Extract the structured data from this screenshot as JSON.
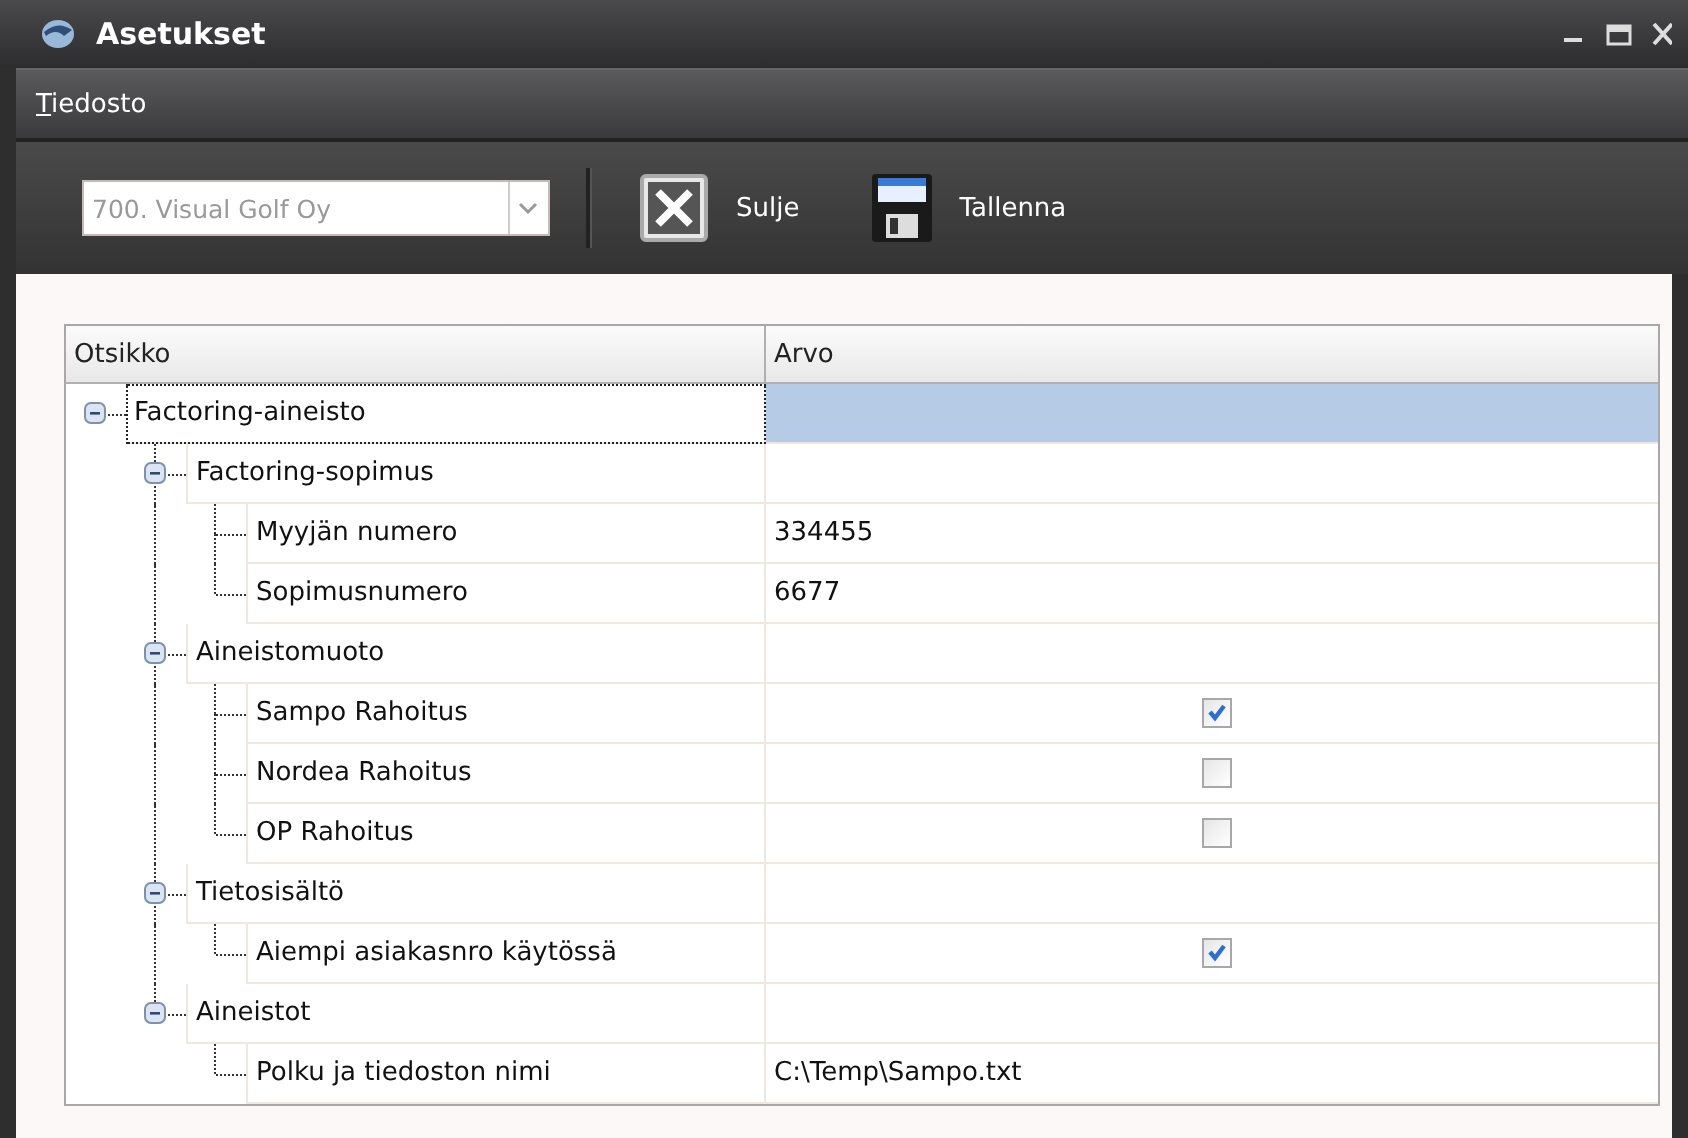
{
  "window": {
    "title": "Asetukset"
  },
  "menu": [
    {
      "label": "Tiedosto"
    }
  ],
  "toolbar": {
    "company_select": {
      "value": "700. Visual Golf Oy",
      "disabled": true
    },
    "buttons": [
      {
        "kind": "close",
        "label": "Sulje"
      },
      {
        "kind": "save",
        "label": "Tallenna"
      }
    ]
  },
  "table": {
    "columns": [
      "Otsikko",
      "Arvo"
    ],
    "rows": [
      {
        "kind": "group",
        "label": "Factoring-aineisto",
        "expanded": true,
        "selected": true,
        "children": [
          {
            "kind": "group",
            "label": "Factoring-sopimus",
            "expanded": true,
            "selected": false,
            "children": [
              {
                "kind": "text",
                "label": "Myyjän numero",
                "value": "334455",
                "selected": false
              },
              {
                "kind": "text",
                "label": "Sopimusnumero",
                "value": "6677",
                "selected": false
              }
            ]
          },
          {
            "kind": "group",
            "label": "Aineistomuoto",
            "expanded": true,
            "selected": false,
            "children": [
              {
                "kind": "checkbox",
                "label": "Sampo Rahoitus",
                "checked": true,
                "selected": false
              },
              {
                "kind": "checkbox",
                "label": "Nordea Rahoitus",
                "checked": false,
                "selected": false
              },
              {
                "kind": "checkbox",
                "label": "OP Rahoitus",
                "checked": false,
                "selected": false
              }
            ]
          },
          {
            "kind": "group",
            "label": "Tietosisältö",
            "expanded": true,
            "selected": false,
            "children": [
              {
                "kind": "checkbox",
                "label": "Aiempi asiakasnro käytössä",
                "checked": true,
                "selected": false
              }
            ]
          },
          {
            "kind": "group",
            "label": "Aineistot",
            "expanded": true,
            "selected": false,
            "children": [
              {
                "kind": "text",
                "label": "Polku ja tiedoston nimi",
                "value": "C:\\Temp\\Sampo.txt",
                "selected": false
              }
            ]
          }
        ]
      }
    ]
  }
}
